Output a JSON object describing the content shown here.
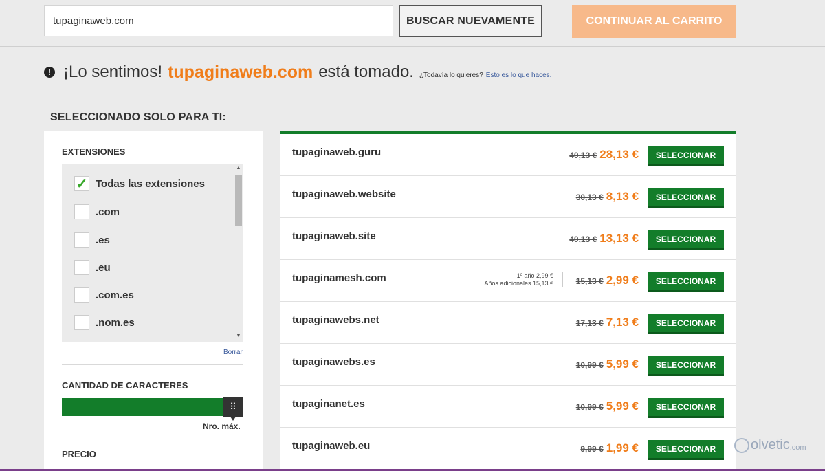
{
  "search": {
    "value": "tupaginaweb.com",
    "button": "BUSCAR NUEVAMENTE"
  },
  "cart_button": "CONTINUAR AL CARRITO",
  "message": {
    "icon": "exclamation-circle-icon",
    "sorry": "¡Lo sentimos!",
    "domain": "tupaginaweb.com",
    "taken": "está tomado.",
    "question": "¿Todavía lo quieres?",
    "link": "Esto es lo que haces."
  },
  "section_title": "SELECCIONADO SOLO PARA TI:",
  "filters": {
    "extensions_title": "EXTENSIONES",
    "extensions": [
      {
        "label": "Todas las extensiones",
        "checked": true
      },
      {
        "label": ".com",
        "checked": false
      },
      {
        "label": ".es",
        "checked": false
      },
      {
        "label": ".eu",
        "checked": false
      },
      {
        "label": ".com.es",
        "checked": false
      },
      {
        "label": ".nom.es",
        "checked": false
      }
    ],
    "clear_link": "Borrar",
    "chars_title": "CANTIDAD DE CARACTERES",
    "chars_max": "Nro. máx.",
    "price_title": "PRECIO"
  },
  "results": [
    {
      "name": "tupaginaweb.guru",
      "old": "40,13 €",
      "new": "28,13 €",
      "button": "SELECCIONAR"
    },
    {
      "name": "tupaginaweb.website",
      "old": "30,13 €",
      "new": "8,13 €",
      "button": "SELECCIONAR"
    },
    {
      "name": "tupaginaweb.site",
      "old": "40,13 €",
      "new": "13,13 €",
      "button": "SELECCIONAR"
    },
    {
      "name": "tupaginamesh.com",
      "old": "15,13 €",
      "new": "2,99 €",
      "button": "SELECCIONAR",
      "promo1": "1º año 2,99 €",
      "promo2": "Años adicionales 15,13 €"
    },
    {
      "name": "tupaginawebs.net",
      "old": "17,13 €",
      "new": "7,13 €",
      "button": "SELECCIONAR"
    },
    {
      "name": "tupaginawebs.es",
      "old": "10,99 €",
      "new": "5,99 €",
      "button": "SELECCIONAR"
    },
    {
      "name": "tupaginanet.es",
      "old": "10,99 €",
      "new": "5,99 €",
      "button": "SELECCIONAR"
    },
    {
      "name": "tupaginaweb.eu",
      "old": "9,99 €",
      "new": "1,99 €",
      "button": "SELECCIONAR"
    }
  ],
  "watermark": {
    "text": "olvetic",
    "suffix": ".com"
  },
  "colors": {
    "accent_orange": "#f07d1a",
    "green": "#137d2a",
    "cart_button": "#f7b98a"
  }
}
